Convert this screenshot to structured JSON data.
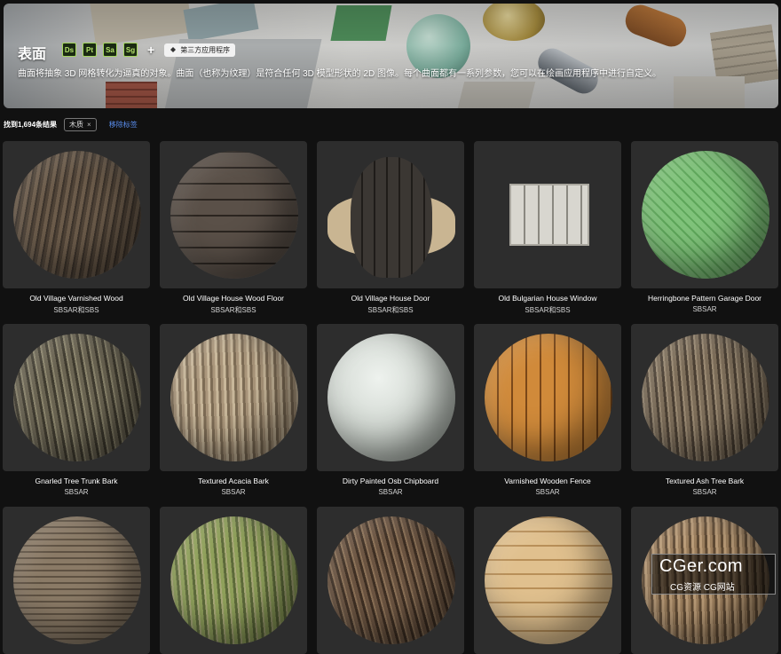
{
  "hero": {
    "title": "表面",
    "apps": [
      "Ds",
      "Pt",
      "Sa",
      "Sg"
    ],
    "plus": "+",
    "third_party": "第三方应用程序",
    "description": "曲面将抽象 3D 网格转化为逼真的对象。曲面（也称为纹理）是符合任何 3D 模型形状的 2D 图像。每个曲面都有一系列参数，您可以在绘画应用程序中进行自定义。"
  },
  "filter": {
    "results": "找到1,694条结果",
    "chip": "木质",
    "chip_close": "×",
    "remove": "移除标签"
  },
  "cards": [
    {
      "name": "Old Village Varnished Wood",
      "format": "SBSAR和SBS",
      "material": "wood-dark"
    },
    {
      "name": "Old Village House Wood Floor",
      "format": "SBSAR和SBS",
      "material": "planks-dark"
    },
    {
      "name": "Old Village House Door",
      "format": "SBSAR和SBS",
      "material": "door"
    },
    {
      "name": "Old Bulgarian House Window",
      "format": "SBSAR和SBS",
      "material": "window"
    },
    {
      "name": "Herringbone Pattern Garage Door",
      "format": "SBSAR",
      "material": "green-herringbone"
    },
    {
      "name": "Gnarled Tree Trunk Bark",
      "format": "SBSAR",
      "material": "bark-gnarled"
    },
    {
      "name": "Textured Acacia Bark",
      "format": "SBSAR",
      "material": "bark-acacia"
    },
    {
      "name": "Dirty Painted Osb Chipboard",
      "format": "SBSAR",
      "material": "osb-white"
    },
    {
      "name": "Varnished Wooden Fence",
      "format": "SBSAR",
      "material": "fence-orange"
    },
    {
      "name": "Textured Ash Tree Bark",
      "format": "SBSAR",
      "material": "bark-ash"
    },
    {
      "name": "",
      "format": "",
      "material": "wood-end-grain"
    },
    {
      "name": "",
      "format": "",
      "material": "bark-mossy"
    },
    {
      "name": "",
      "format": "",
      "material": "bark-brown"
    },
    {
      "name": "",
      "format": "",
      "material": "planks-light"
    },
    {
      "name": "",
      "format": "",
      "material": "bark-tan"
    }
  ],
  "watermark": {
    "line1": "CGer.com",
    "line2": "CG资源 CG网站"
  },
  "colors": {
    "background": "#111111",
    "card": "#2d2d2d",
    "link": "#5a8ff0",
    "badge_green": "#a4d65e"
  }
}
